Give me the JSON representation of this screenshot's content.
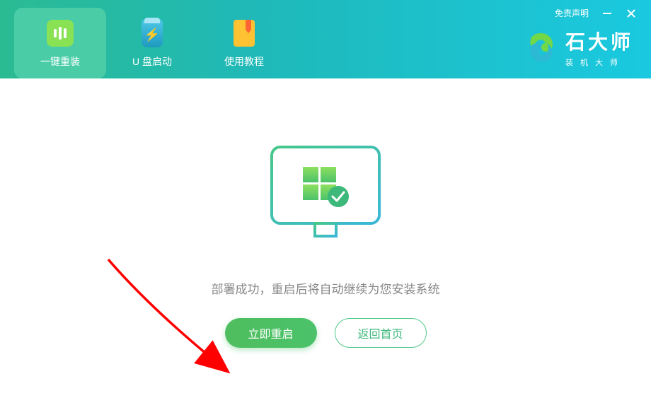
{
  "header": {
    "tabs": [
      {
        "label": "一键重装",
        "active": true
      },
      {
        "label": "U 盘启动",
        "active": false
      },
      {
        "label": "使用教程",
        "active": false
      }
    ],
    "disclaimer": "免责声明",
    "brand": {
      "name": "石大师",
      "subtitle": "装机大师"
    }
  },
  "main": {
    "message": "部署成功，重启后将自动继续为您安装系统",
    "primaryButton": "立即重启",
    "secondaryButton": "返回首页"
  }
}
